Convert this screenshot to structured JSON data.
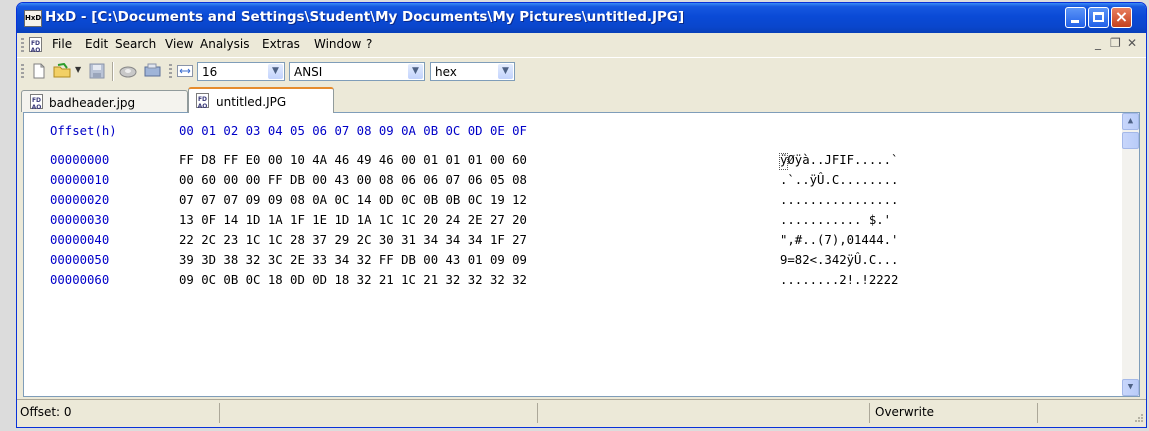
{
  "window": {
    "app_icon_text": "HxD",
    "title": "HxD - [C:\\Documents and Settings\\Student\\My Documents\\My Pictures\\untitled.JPG]"
  },
  "menu": {
    "items": [
      "File",
      "Edit",
      "Search",
      "View",
      "Analysis",
      "Extras",
      "Window",
      "?"
    ]
  },
  "toolbar": {
    "bytes_per_row": "16",
    "charset": "ANSI",
    "offset_base": "hex"
  },
  "tabs": [
    {
      "label": "badheader.jpg",
      "active": false
    },
    {
      "label": "untitled.JPG",
      "active": true
    }
  ],
  "editor": {
    "offset_header": "Offset(h)",
    "column_header": "00 01 02 03 04 05 06 07 08 09 0A 0B 0C 0D 0E 0F",
    "rows": [
      {
        "offset": "00000000",
        "hex": "FF D8 FF E0 00 10 4A 46 49 46 00 01 01 01 00 60",
        "ascii": "ÿØÿà..JFIF.....`"
      },
      {
        "offset": "00000010",
        "hex": "00 60 00 00 FF DB 00 43 00 08 06 06 07 06 05 08",
        "ascii": ".`..ÿÛ.C........"
      },
      {
        "offset": "00000020",
        "hex": "07 07 07 09 09 08 0A 0C 14 0D 0C 0B 0B 0C 19 12",
        "ascii": "................"
      },
      {
        "offset": "00000030",
        "hex": "13 0F 14 1D 1A 1F 1E 1D 1A 1C 1C 20 24 2E 27 20",
        "ascii": "........... $.' "
      },
      {
        "offset": "00000040",
        "hex": "22 2C 23 1C 1C 28 37 29 2C 30 31 34 34 34 1F 27",
        "ascii": "\",#..(7),01444.'"
      },
      {
        "offset": "00000050",
        "hex": "39 3D 38 32 3C 2E 33 34 32 FF DB 00 43 01 09 09",
        "ascii": "9=82<.342ÿÛ.C..."
      },
      {
        "offset": "00000060",
        "hex": "09 0C 0B 0C 18 0D 0D 18 32 21 1C 21 32 32 32 32",
        "ascii": "........2!.!2222"
      }
    ]
  },
  "status": {
    "offset": "Offset: 0",
    "mode": "Overwrite"
  }
}
